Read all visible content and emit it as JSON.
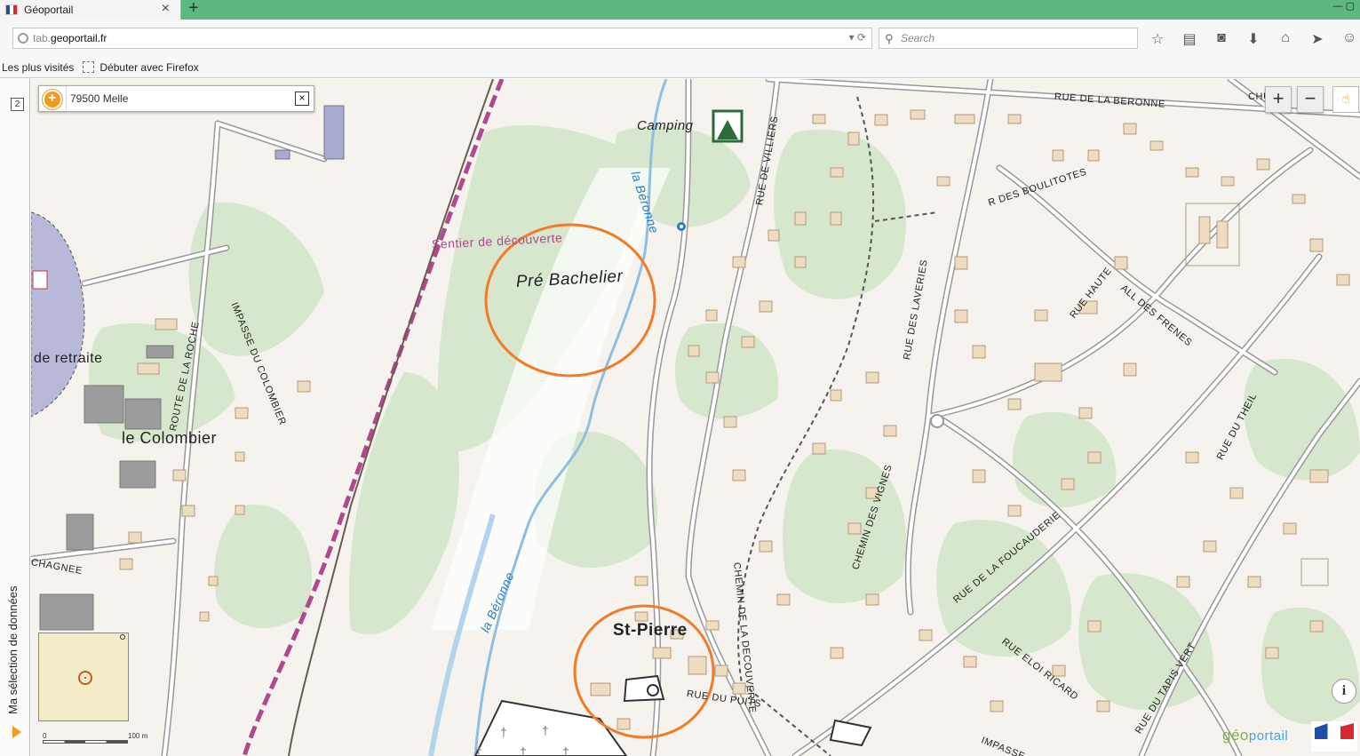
{
  "browser": {
    "tab_title": "Géoportail",
    "tab_close": "×",
    "new_tab": "+",
    "url_host": "geoportail.fr",
    "url_prefix": "tab.",
    "search_placeholder": "Search",
    "bookmarks": [
      "Les plus visités",
      "Débuter avec Firefox"
    ]
  },
  "sidebar": {
    "number": "2",
    "label": "Ma sélection de données"
  },
  "search_panel": {
    "value": "79500 Melle",
    "clear": "×"
  },
  "zoom": {
    "plus": "+",
    "minus": "−"
  },
  "labels": {
    "pre_bachelier": "Pré Bachelier",
    "st_pierre": "St-Pierre",
    "le_colombier": "le Colombier",
    "de_retraite": "de retraite",
    "camping": "Camping",
    "sentier": "Sentier de découverte",
    "beronne_top": "la Béronne",
    "beronne_bottom": "la Béronne",
    "rue_beronne": "RUE DE LA BERONNE",
    "rue_villiers": "RUE DE VILLIERS",
    "r_boulitotes": "R DES BOULITOTES",
    "route_roche": "ROUTE DE LA ROCHE",
    "impasse_colombier": "IMPASSE DU COLOMBIER",
    "rue_laveries": "RUE DES LAVERIES",
    "rue_haute": "RUE HAUTE",
    "all_frenes": "ALL DES FRENES",
    "rue_theil": "RUE DU THEIL",
    "chemin_vignes": "CHEMIN DES VIGNES",
    "rue_foucauderie": "RUE DE LA FOUCAUDERIE",
    "chemin_decouverte": "CHEMIN DE LA DECOUVERTE",
    "rue_eloi_ricard": "RUE ELOI RICARD",
    "rue_tapis_vert": "RUE DU TAPIS VERT",
    "rue_puits": "RUE DU PUITS",
    "impasse": "IMPASSE",
    "chagnee": "CHAGNEE",
    "chu": "CHU"
  },
  "scale": {
    "start": "0",
    "end": "100 m"
  },
  "info": "i",
  "logo": {
    "geo": "géo",
    "portail": "portail"
  },
  "colors": {
    "tabbar": "#5cb87f",
    "accent": "#f39a1e",
    "circle": "#f07c2a",
    "river": "#2e7cc3",
    "trail": "#b0488d"
  }
}
